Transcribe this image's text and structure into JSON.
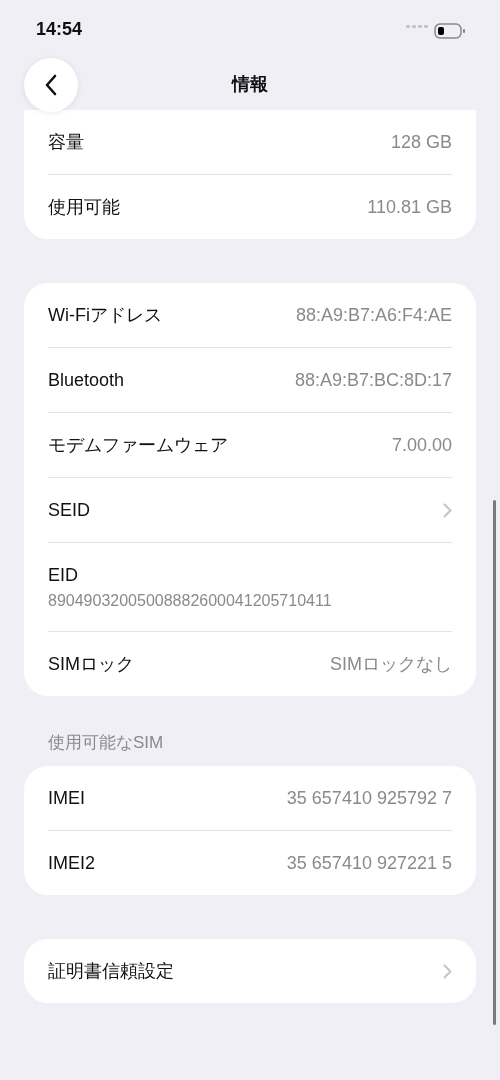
{
  "status_bar": {
    "time": "14:54"
  },
  "nav": {
    "title": "情報"
  },
  "groups": [
    {
      "rows": [
        {
          "kind": "value",
          "label": "容量",
          "value": "128 GB"
        },
        {
          "kind": "value",
          "label": "使用可能",
          "value": "110.81 GB"
        }
      ],
      "cut_top": true
    },
    {
      "rows": [
        {
          "kind": "value",
          "label": "Wi-Fiアドレス",
          "value": "88:A9:B7:A6:F4:AE"
        },
        {
          "kind": "value",
          "label": "Bluetooth",
          "value": "88:A9:B7:BC:8D:17"
        },
        {
          "kind": "value",
          "label": "モデムファームウェア",
          "value": "7.00.00"
        },
        {
          "kind": "link",
          "label": "SEID"
        },
        {
          "kind": "stacked",
          "label": "EID",
          "value": "89049032005008882600041205710411"
        },
        {
          "kind": "value",
          "label": "SIMロック",
          "value": "SIMロックなし"
        }
      ]
    },
    {
      "header": "使用可能なSIM",
      "rows": [
        {
          "kind": "value",
          "label": "IMEI",
          "value": "35 657410 925792 7"
        },
        {
          "kind": "value",
          "label": "IMEI2",
          "value": "35 657410 927221 5"
        }
      ]
    },
    {
      "rows": [
        {
          "kind": "link",
          "label": "証明書信頼設定"
        }
      ]
    }
  ]
}
